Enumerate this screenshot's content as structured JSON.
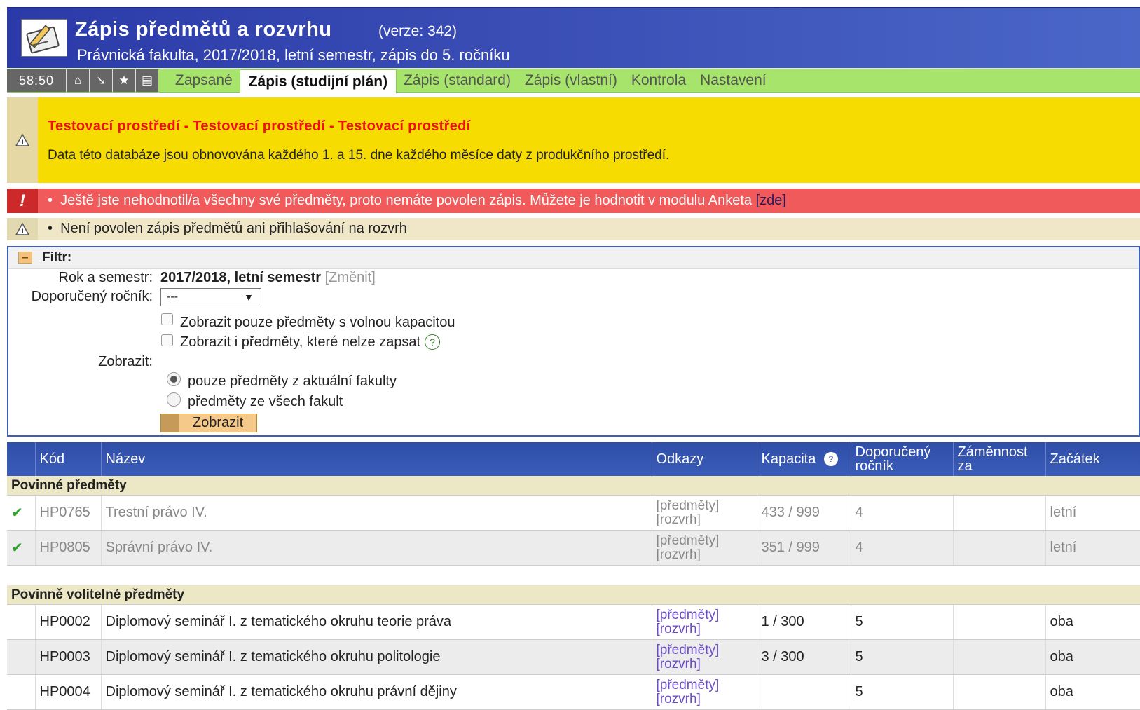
{
  "app": {
    "title": "Zápis předmětů a rozvrhu",
    "version": "(verze: 342)",
    "subtitle": "Právnická fakulta, 2017/2018, letní semestr, zápis do 5. ročníku"
  },
  "nav": {
    "timer": "58:50",
    "icons": [
      "home-icon",
      "arrow-down-right-icon",
      "star-icon",
      "print-icon"
    ],
    "tabs": [
      {
        "label": "Zapsané",
        "active": false
      },
      {
        "label": "Zápis (studijní plán)",
        "active": true
      },
      {
        "label": "Zápis (standard)",
        "active": false
      },
      {
        "label": "Zápis (vlastní)",
        "active": false
      },
      {
        "label": "Kontrola",
        "active": false
      },
      {
        "label": "Nastavení",
        "active": false
      }
    ]
  },
  "notices": {
    "test_title": "Testovací prostředí - Testovací prostředí - Testovací prostředí",
    "test_text": "Data této databáze jsou obnovována každého 1. a 15. dne každého měsíce daty z produkčního prostředí.",
    "error_text": "Ještě jste nehodnotil/a všechny své předměty, proto nemáte povolen zápis. Můžete je hodnotit v modulu Anketa",
    "error_link": "[zde]",
    "info_text": "Není povolen zápis předmětů ani přihlašování na rozvrh"
  },
  "filter": {
    "title": "Filtr:",
    "semester_label": "Rok a semestr:",
    "semester_value": "2017/2018, letní semestr",
    "semester_change": "[Změnit]",
    "year_label": "Doporučený ročník:",
    "year_value": "---",
    "chk_capacity": "Zobrazit pouze předměty s volnou kapacitou",
    "chk_unavailable": "Zobrazit i předměty, které nelze zapsat",
    "show_label": "Zobrazit:",
    "radio_current": "pouze předměty z aktuální fakulty",
    "radio_all": "předměty ze všech fakult",
    "submit": "Zobrazit"
  },
  "table": {
    "headers": {
      "code": "Kód",
      "name": "Název",
      "links": "Odkazy",
      "capacity": "Kapacita",
      "year1": "Doporučený",
      "year2": "ročník",
      "exch1": "Záměnnost",
      "exch2": "za",
      "start": "Začátek"
    },
    "group1": "Povinné předměty",
    "group2": "Povinně volitelné předměty",
    "link_subjects": "[předměty]",
    "link_schedule": "[rozvrh]",
    "rows1": [
      {
        "code": "HP0765",
        "name": "Trestní právo IV.",
        "capacity": "433 / 999",
        "year": "4",
        "start": "letní"
      },
      {
        "code": "HP0805",
        "name": "Správní právo IV.",
        "capacity": "351 / 999",
        "year": "4",
        "start": "letní"
      }
    ],
    "rows2": [
      {
        "code": "HP0002",
        "name": "Diplomový seminář I. z tematického okruhu teorie práva",
        "capacity": "1 / 300",
        "year": "5",
        "start": "oba"
      },
      {
        "code": "HP0003",
        "name": "Diplomový seminář I. z tematického okruhu politologie",
        "capacity": "3 / 300",
        "year": "5",
        "start": "oba"
      },
      {
        "code": "HP0004",
        "name": "Diplomový seminář I. z tematického okruhu právní dějiny",
        "capacity": "",
        "year": "5",
        "start": "oba"
      }
    ]
  }
}
